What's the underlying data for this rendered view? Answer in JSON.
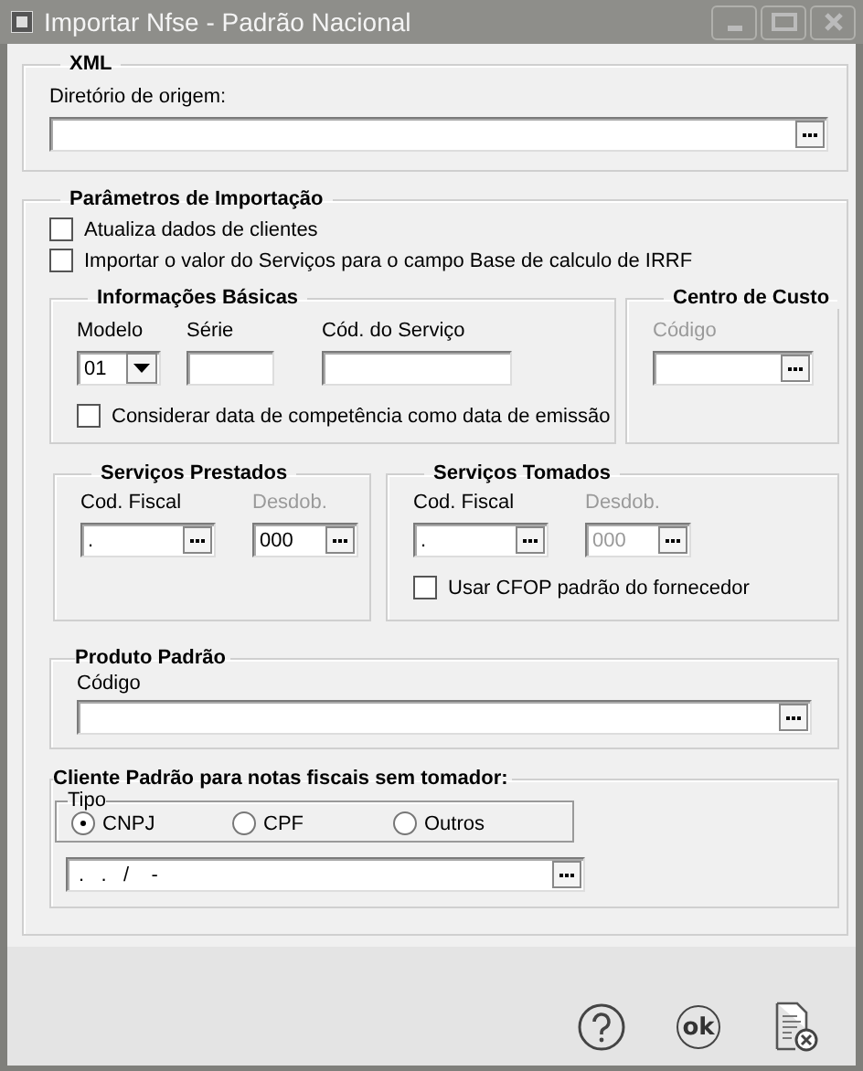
{
  "window": {
    "title": "Importar Nfse - Padrão Nacional"
  },
  "xml": {
    "legend": "XML",
    "label": "Diretório de origem:"
  },
  "import_params": {
    "legend": "Parâmetros de Importação",
    "checkboxes": [
      {
        "label": "Atualiza dados de clientes",
        "checked": false
      },
      {
        "label": "Importar o valor do Serviços para o campo Base de calculo de IRRF",
        "checked": false
      }
    ],
    "basic_info": {
      "legend": "Informações Básicas",
      "modelo": {
        "label": "Modelo",
        "value": "01"
      },
      "serie": {
        "label": "Série"
      },
      "cod_servico": {
        "label": "Cód. do Serviço"
      },
      "checkbox": {
        "label": "Considerar data de competência como data de emissão",
        "checked": false
      }
    },
    "cost_center": {
      "legend": "Centro de Custo",
      "code": {
        "label": "Código",
        "disabled": true
      }
    },
    "services_provided": {
      "legend": "Serviços Prestados",
      "cod_fiscal": {
        "label": "Cod. Fiscal",
        "value": ".",
        "disabled": false
      },
      "desdob": {
        "label": "Desdob.",
        "value": "000",
        "disabled": true,
        "value_disabled": false
      }
    },
    "services_taken": {
      "legend": "Serviços Tomados",
      "cod_fiscal": {
        "label": "Cod. Fiscal",
        "value": ".",
        "disabled": false
      },
      "desdob": {
        "label": "Desdob.",
        "value": "000",
        "disabled": true,
        "value_disabled": true
      },
      "checkbox": {
        "label": "Usar CFOP padrão do fornecedor",
        "checked": false
      }
    },
    "default_product": {
      "legend": "Produto Padrão",
      "code": {
        "label": "Código"
      }
    },
    "default_client": {
      "legend": "Cliente Padrão para notas fiscais sem tomador:",
      "type_group": {
        "legend": "Tipo",
        "options": [
          {
            "label": "CNPJ",
            "selected": true
          },
          {
            "label": "CPF",
            "selected": false
          },
          {
            "label": "Outros",
            "selected": false
          }
        ]
      },
      "document": {
        "value": " .   .   /    -"
      }
    }
  },
  "footer_buttons": [
    {
      "kind": "help"
    },
    {
      "kind": "ok",
      "label": "ok"
    },
    {
      "kind": "cancel"
    }
  ]
}
